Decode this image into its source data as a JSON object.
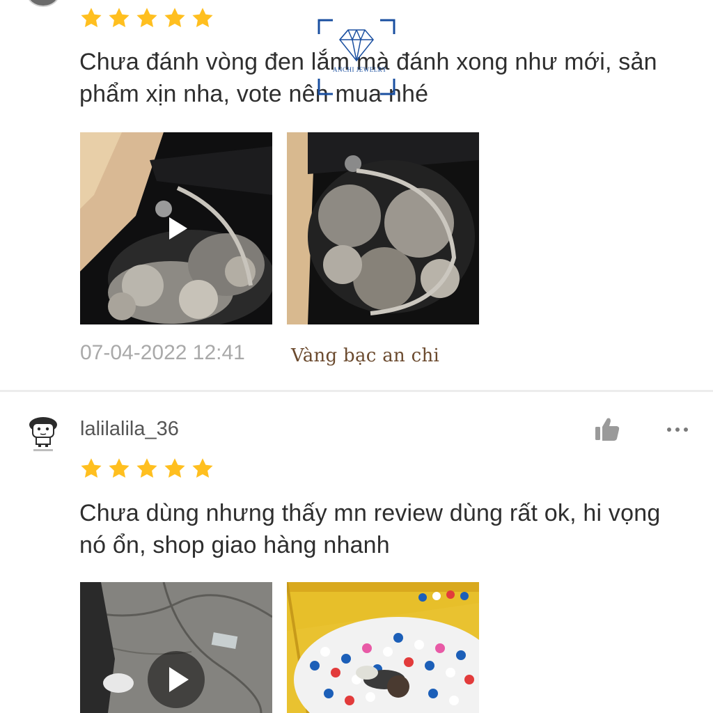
{
  "reviews": [
    {
      "username": "",
      "rating": 5,
      "text_line1": "Chưa đánh vòng đen lắm mà đánh xong như mới, sản",
      "text_line2": "phẩm xịn nha, vote nên mua nhé",
      "timestamp": "07-04-2022 12:41",
      "media": [
        {
          "kind": "video",
          "icon": "play-icon"
        },
        {
          "kind": "image"
        }
      ]
    },
    {
      "username": "lalilalila_36",
      "rating": 5,
      "text_line1": "Chưa dùng nhưng thấy mn review dùng rất ok, hi vọng",
      "text_line2": "nó ổn, shop giao hàng nhanh",
      "media": [
        {
          "kind": "video",
          "icon": "play-icon"
        },
        {
          "kind": "image"
        }
      ]
    }
  ],
  "watermark": {
    "logo_text": "ANCHI JEWELRY",
    "caption": "Vàng bạc an chi"
  },
  "icons": {
    "like": "thumbs-up-icon",
    "more": "more-options-icon",
    "star": "star-icon"
  },
  "colors": {
    "star": "#ffbf1f",
    "text": "#2e2e2e",
    "muted": "#a9a9a9",
    "logo_blue": "#1a4fa0",
    "watermark_brown": "#6b4a2e"
  }
}
